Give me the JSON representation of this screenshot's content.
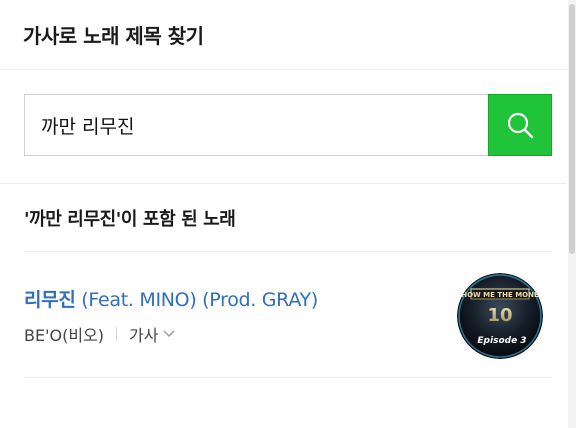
{
  "header": {
    "title": "가사로 노래 제목 찾기"
  },
  "search": {
    "value": "까만 리무진",
    "button_icon": "search-icon",
    "button_color": "#1fc438"
  },
  "results": {
    "heading": "'까만 리무진'이 포함 된 노래",
    "items": [
      {
        "title_highlight": "리무진",
        "title_rest": " (Feat. MINO) (Prod. GRAY)",
        "artist": "BE'O(비오)",
        "lyrics_label": "가사",
        "album_art": {
          "logo_text": "SHOW ME THE MONEY",
          "number": "10",
          "subtitle": "Episode 3"
        }
      }
    ]
  },
  "colors": {
    "accent": "#1fc438",
    "link": "#2f6fbe"
  }
}
